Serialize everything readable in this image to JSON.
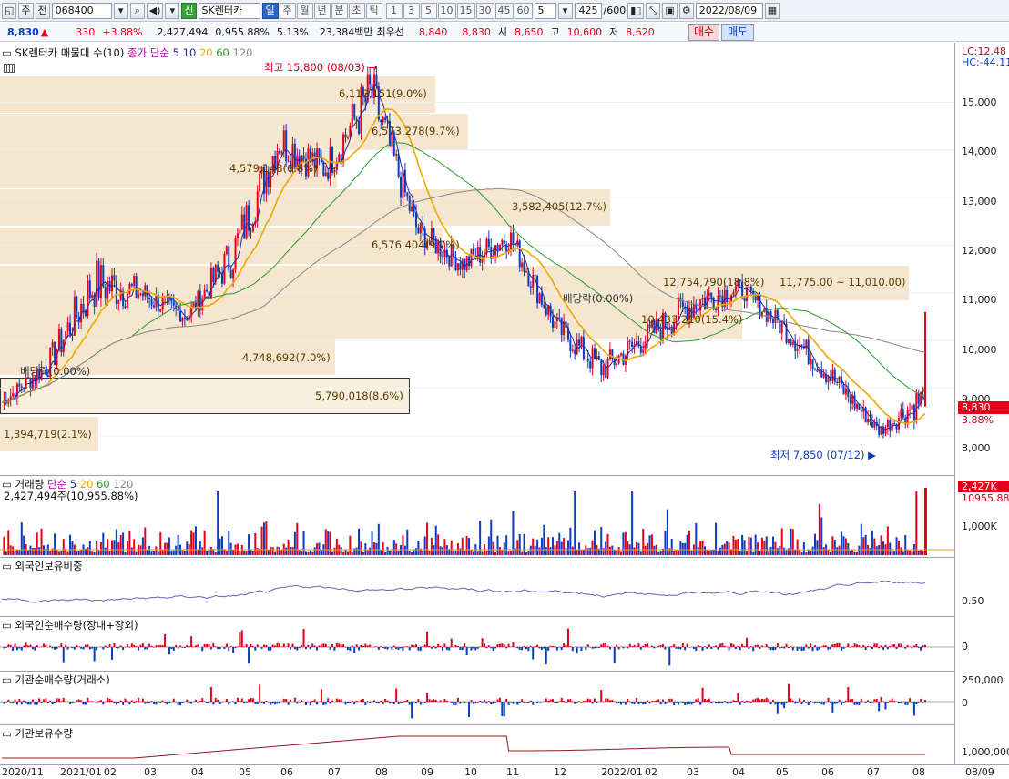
{
  "toolbar": {
    "market": "주",
    "prev": "전",
    "code": "068400",
    "name": "SK렌터카",
    "new_badge": "신",
    "periods": [
      "일",
      "주",
      "월",
      "년",
      "분",
      "초",
      "틱"
    ],
    "minutes": [
      "1",
      "3",
      "5",
      "10",
      "15",
      "30",
      "45",
      "60"
    ],
    "interval": "5",
    "count": "425",
    "count_total": "/600",
    "date": "2022/08/09"
  },
  "quote": {
    "price": "8,830",
    "change": "330",
    "change_pct": "+3.88%",
    "volume": "2,427,494",
    "volume_pct": "0,955.88%",
    "turnover": "5.13%",
    "amount": "23,384백만",
    "best_sell_label": "최우선",
    "best_sell": "8,840",
    "best_buy": "8,830",
    "open_label": "시",
    "open": "8,650",
    "high_label": "고",
    "high": "10,600",
    "low_label": "저",
    "low": "8,620",
    "buy_btn": "매수",
    "sell_btn": "매도"
  },
  "price_pane": {
    "title": "SK렌터카 매물대 수(10)",
    "ma_label": "종가 단순",
    "ma": [
      "5",
      "10",
      "20",
      "60",
      "120"
    ],
    "high_note": "최고 15,800 (08/03)",
    "low_note": "최저 7,850 (07/12)",
    "div_note1": "배당락(0.00%)",
    "div_note2": "배당락(0.00%)",
    "lc": "LC:12.48",
    "hc": "HC:-44.11",
    "current_price": "8,830",
    "current_pct": "3.88%",
    "yticks": [
      "15,000",
      "14,000",
      "13,000",
      "12,000",
      "11,000",
      "10,000",
      "9,000",
      "8,000"
    ],
    "bands": [
      "1,394,719(2.1%)",
      "5,790,018(8.6%)",
      "4,748,692(7.0%)",
      "10,433,210(15.4%)",
      "6,576,404(9.7%)",
      "3,582,405(12.7%)",
      "4,579,148(6.8%)",
      "6,573,278(9.7%)",
      "6,112,151(9.0%)",
      "12,754,790(18.8%)",
      "11,775.00 ~ 11,010.00)"
    ]
  },
  "volume_pane": {
    "title": "거래량",
    "ma_label": "단순",
    "ma": [
      "5",
      "20",
      "60",
      "120"
    ],
    "value": "2,427,494주(10,955.88%)",
    "axis_label": "1,000K",
    "badge": "2,427K",
    "badge_pct": "10955.88%"
  },
  "foreign_pane": {
    "title": "외국인보유비중",
    "axis_label": "0.50"
  },
  "foreign_net_pane": {
    "title": "외국인순매수량(장내+장외)",
    "axis_label": "0"
  },
  "inst_net_pane": {
    "title": "기관순매수량(거래소)",
    "axis_top": "250,000",
    "axis_label": "0"
  },
  "inst_hold_pane": {
    "title": "기관보유수량",
    "axis_label": "1,000,000"
  },
  "x_dates": [
    "2020/11",
    "2021/01",
    "02",
    "03",
    "04",
    "05",
    "06",
    "07",
    "08",
    "09",
    "10",
    "11",
    "12",
    "2022/01",
    "02",
    "03",
    "04",
    "05",
    "06",
    "07",
    "08",
    "08/09"
  ],
  "colors": {
    "up": "#e3001b",
    "down": "#0a3cc2",
    "ma5": "#2a2aa8",
    "ma20": "#f0a800",
    "ma60": "#2c9a2c",
    "ma120": "#888888",
    "band": "#f5e6cf"
  },
  "chart_data": {
    "type": "candlestick",
    "title": "SK렌터카",
    "categories": [
      "2020/11",
      "2021/01",
      "02",
      "03",
      "04",
      "05",
      "06",
      "07",
      "08",
      "09",
      "10",
      "11",
      "12",
      "2022/01",
      "02",
      "03",
      "04",
      "05",
      "06",
      "07",
      "08"
    ],
    "close": [
      8700,
      9500,
      11200,
      11000,
      10500,
      11800,
      14200,
      13600,
      15200,
      12300,
      11600,
      12200,
      10300,
      9400,
      10100,
      10800,
      11100,
      10200,
      9200,
      8100,
      8830
    ],
    "high": [
      9100,
      10300,
      13000,
      12200,
      11000,
      13200,
      15400,
      15000,
      15800,
      13200,
      12400,
      12300,
      11100,
      10600,
      10800,
      12200,
      11700,
      11300,
      10200,
      8600,
      10600
    ],
    "low": [
      8500,
      8600,
      9700,
      10300,
      10100,
      10400,
      12600,
      13000,
      12100,
      11600,
      10900,
      10500,
      9500,
      8800,
      9100,
      9900,
      10600,
      9800,
      8600,
      7850,
      8250
    ],
    "ylim": [
      7600,
      16000
    ],
    "volume_peak": 2427494
  }
}
